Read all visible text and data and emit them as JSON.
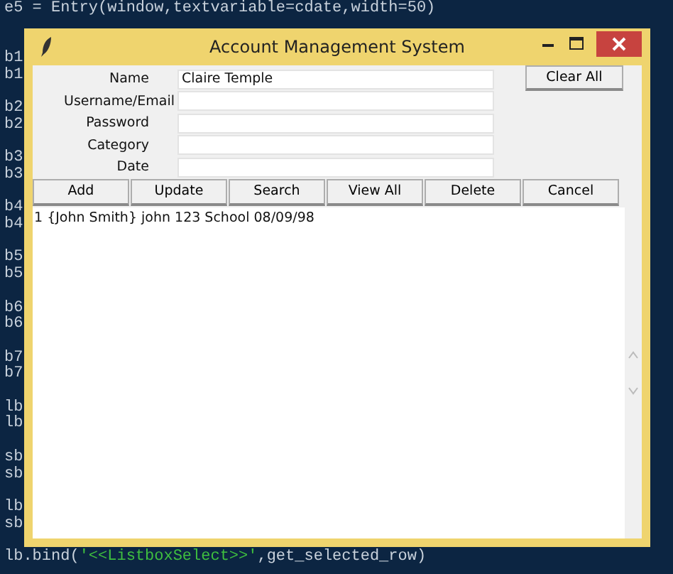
{
  "editor": {
    "blocks": [
      {
        "lines": [
          [
            {
              "text": "e5 = Entry(window,textvariable=cdate,width=50)",
              "kind": "code"
            }
          ]
        ]
      },
      {
        "lines": [
          [
            {
              "text": "b1",
              "kind": "code"
            }
          ],
          [
            {
              "text": "b1",
              "kind": "code"
            }
          ]
        ]
      },
      {
        "lines": [
          [
            {
              "text": "b2",
              "kind": "code"
            }
          ],
          [
            {
              "text": "b2",
              "kind": "code"
            }
          ]
        ]
      },
      {
        "lines": [
          [
            {
              "text": "b3",
              "kind": "code"
            }
          ],
          [
            {
              "text": "b3",
              "kind": "code"
            }
          ]
        ]
      },
      {
        "lines": [
          [
            {
              "text": "b4",
              "kind": "code"
            }
          ],
          [
            {
              "text": "b4",
              "kind": "code"
            }
          ]
        ]
      },
      {
        "lines": [
          [
            {
              "text": "b5",
              "kind": "code"
            }
          ],
          [
            {
              "text": "b5",
              "kind": "code"
            }
          ]
        ]
      },
      {
        "lines": [
          [
            {
              "text": "b6",
              "kind": "code"
            }
          ],
          [
            {
              "text": "b6",
              "kind": "code"
            }
          ]
        ]
      },
      {
        "lines": [
          [
            {
              "text": "b7",
              "kind": "code"
            }
          ],
          [
            {
              "text": "b7",
              "kind": "code"
            }
          ]
        ]
      },
      {
        "lines": [
          [
            {
              "text": "lb",
              "kind": "code"
            }
          ],
          [
            {
              "text": "lb",
              "kind": "code"
            }
          ]
        ]
      },
      {
        "lines": [
          [
            {
              "text": "sb",
              "kind": "code"
            }
          ],
          [
            {
              "text": "sb",
              "kind": "code"
            }
          ]
        ]
      },
      {
        "lines": [
          [
            {
              "text": "lb",
              "kind": "code"
            }
          ],
          [
            {
              "text": "sb",
              "kind": "code"
            }
          ]
        ]
      },
      {
        "lines": [
          [
            {
              "text": "lb.bind(",
              "kind": "code"
            },
            {
              "text": "'<<ListboxSelect>>'",
              "kind": "string"
            },
            {
              "text": ",get_selected_row)",
              "kind": "code"
            }
          ]
        ]
      }
    ]
  },
  "window": {
    "title": "Account Management System",
    "fields": [
      {
        "label": "Name",
        "value": "Claire Temple"
      },
      {
        "label": "Username/Email"
      },
      {
        "label": "Password"
      },
      {
        "label": "Category"
      },
      {
        "label": "Date"
      }
    ],
    "side_button": "Clear All",
    "buttons": [
      "Add",
      "Update",
      "Search",
      "View All",
      "Delete",
      "Cancel"
    ],
    "list": {
      "rows": [
        "1 {John Smith} john 123 School 08/09/98"
      ]
    }
  }
}
